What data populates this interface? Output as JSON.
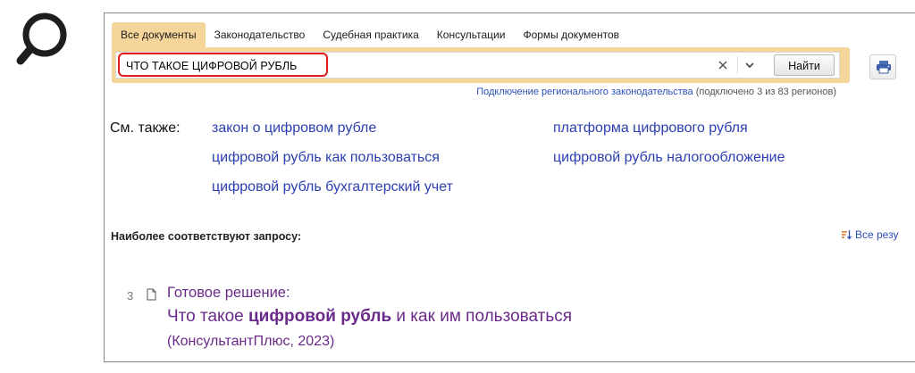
{
  "tabs": [
    {
      "label": "Все документы",
      "active": true
    },
    {
      "label": "Законодательство",
      "active": false
    },
    {
      "label": "Судебная практика",
      "active": false
    },
    {
      "label": "Консультации",
      "active": false
    },
    {
      "label": "Формы документов",
      "active": false
    }
  ],
  "search": {
    "query": "ЧТО ТАКОЕ ЦИФРОВОЙ РУБЛЬ",
    "find_label": "Найти"
  },
  "regional": {
    "link_text": "Подключение регионального законодательства",
    "status_text": " (подключено 3 из 83 регионов)"
  },
  "see_also": {
    "label": "См. также:",
    "links": [
      "закон о цифровом рубле",
      "цифровой рубль как пользоваться",
      "цифровой рубль бухгалтерский учет",
      "платформа цифрового рубля",
      "цифровой рубль налогообложение"
    ]
  },
  "results": {
    "section_title": "Наиболее соответствуют запросу:",
    "all_results_label": "Все резу",
    "items": [
      {
        "number": "3",
        "kind": "Готовое решение:",
        "title_before": "Что такое ",
        "title_bold": "цифровой рубль",
        "title_after": " и как им пользоваться",
        "source": "(КонсультантПлюс, 2023)"
      }
    ]
  },
  "colors": {
    "tab_active_bg": "#f6d59b",
    "link_blue": "#2b3fb0",
    "result_purple": "#6a2a8a",
    "highlight_red": "#e01b1b"
  },
  "icons": {
    "magnifier": "magnifier-icon",
    "clear": "close-icon",
    "dropdown": "chevron-down-icon",
    "print": "printer-icon",
    "document": "document-icon",
    "sort": "sort-icon"
  }
}
